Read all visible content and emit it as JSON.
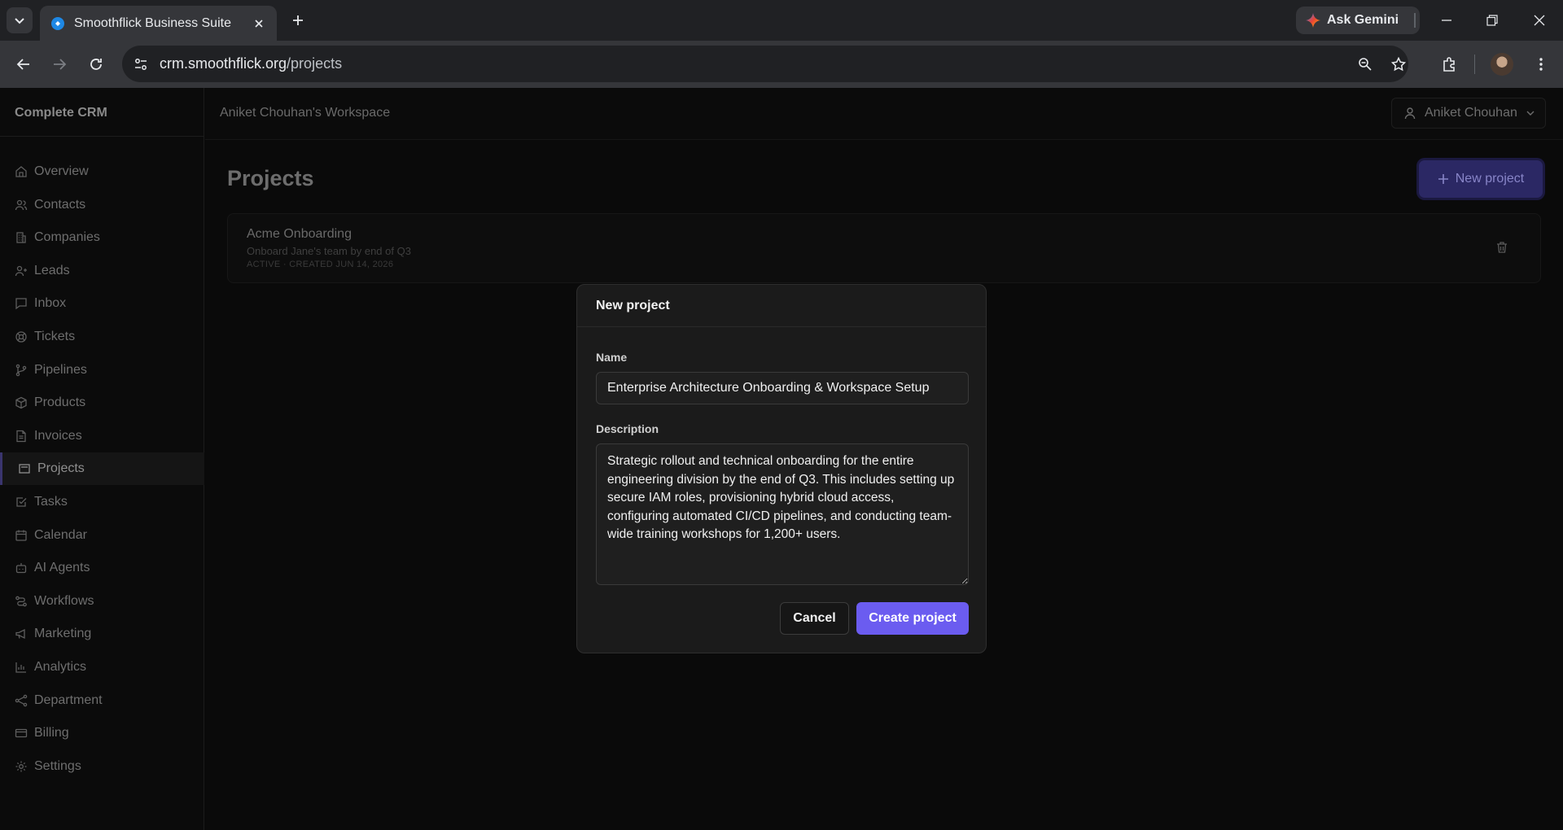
{
  "browser": {
    "tab_title": "Smoothflick Business Suite",
    "url_host": "crm.smoothflick.org",
    "url_path": "/projects",
    "gemini_label": "Ask Gemini"
  },
  "app": {
    "brand": "Complete CRM",
    "workspace": "Aniket Chouhan's Workspace",
    "user_name": "Aniket Chouhan"
  },
  "sidebar": {
    "items": [
      {
        "label": "Overview",
        "icon": "home-icon"
      },
      {
        "label": "Contacts",
        "icon": "users-icon"
      },
      {
        "label": "Companies",
        "icon": "building-icon"
      },
      {
        "label": "Leads",
        "icon": "user-plus-icon"
      },
      {
        "label": "Inbox",
        "icon": "message-icon"
      },
      {
        "label": "Tickets",
        "icon": "lifebuoy-icon"
      },
      {
        "label": "Pipelines",
        "icon": "git-branch-icon"
      },
      {
        "label": "Products",
        "icon": "package-icon"
      },
      {
        "label": "Invoices",
        "icon": "file-text-icon"
      },
      {
        "label": "Projects",
        "icon": "folder-icon"
      },
      {
        "label": "Tasks",
        "icon": "check-square-icon"
      },
      {
        "label": "Calendar",
        "icon": "calendar-icon"
      },
      {
        "label": "AI Agents",
        "icon": "bot-icon"
      },
      {
        "label": "Workflows",
        "icon": "workflow-icon"
      },
      {
        "label": "Marketing",
        "icon": "megaphone-icon"
      },
      {
        "label": "Analytics",
        "icon": "bar-chart-icon"
      },
      {
        "label": "Department",
        "icon": "network-icon"
      },
      {
        "label": "Billing",
        "icon": "credit-card-icon"
      },
      {
        "label": "Settings",
        "icon": "gear-icon"
      }
    ],
    "active": "Projects"
  },
  "page": {
    "title": "Projects",
    "new_button": "New project"
  },
  "project_card": {
    "name": "Acme Onboarding",
    "description": "Onboard Jane's team by end of Q3",
    "meta": "ACTIVE · CREATED JUN 14, 2026"
  },
  "modal": {
    "title": "New project",
    "name_label": "Name",
    "name_value": "Enterprise Architecture Onboarding & Workspace Setup",
    "description_label": "Description",
    "description_value": "Strategic rollout and technical onboarding for the entire engineering division by the end of Q3. This includes setting up secure IAM roles, provisioning hybrid cloud access, configuring automated CI/CD pipelines, and conducting team-wide training workshops for 1,200+ users.",
    "cancel": "Cancel",
    "create": "Create project"
  },
  "colors": {
    "accent": "#6b5cf0",
    "background": "#0a0a0a",
    "modal": "#1b1b1b"
  }
}
